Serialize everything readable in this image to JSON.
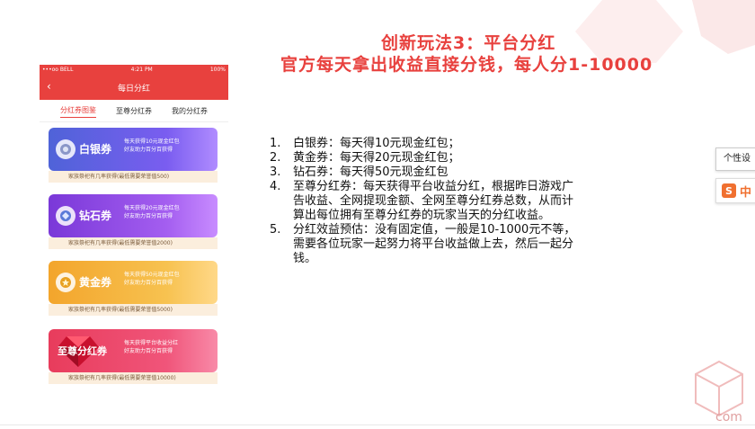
{
  "slide": {
    "title_line1": "创新玩法3：平台分红",
    "title_line2": "官方每天拿出收益直接分钱，每人分1-10000"
  },
  "phone": {
    "status": {
      "carrier": "•••oo BELL",
      "time": "4:21 PM",
      "battery": "100%"
    },
    "nav_title": "每日分红",
    "tabs": [
      {
        "label": "分红券图鉴",
        "active": true
      },
      {
        "label": "至尊分红券",
        "active": false
      },
      {
        "label": "我的分红券",
        "active": false
      }
    ],
    "cards": [
      {
        "name": "白银券",
        "desc1": "每天获得10元现金红包",
        "desc2": "好友助力百分百获得",
        "foot": "家族祭祀有几率获得(最低需要荣誉值500)"
      },
      {
        "name": "钻石券",
        "desc1": "每天获得20元现金红包",
        "desc2": "好友助力百分百获得",
        "foot": "家族祭祀有几率获得(最低需要荣誉值2000)"
      },
      {
        "name": "黄金券",
        "desc1": "每天获得50元现金红包",
        "desc2": "好友助力百分百获得",
        "foot": "家族祭祀有几率获得(最低需要荣誉值5000)"
      },
      {
        "name": "至尊分红券",
        "desc1": "每天获得平台收益分红",
        "desc2": "好友助力百分百获得",
        "foot": "家族祭祀有几率获得(最低需要荣誉值10000)"
      }
    ]
  },
  "list": [
    {
      "num": "1.",
      "text": "白银券：每天得10元现金红包；"
    },
    {
      "num": "2.",
      "text": "黄金券：每天得20元现金红包；"
    },
    {
      "num": "3.",
      "text": "钻石券：每天得50元现金红包"
    },
    {
      "num": "4.",
      "text": "至尊分红券：每天获得平台收益分红，根据昨日游戏广告收益、全网提现金额、全网至尊分红券总数，从而计算出每位拥有至尊分红券的玩家当天的分红收益。"
    },
    {
      "num": "5.",
      "text": "分红效益预估：没有固定值，一般是10-1000元不等，需要各位玩家一起努力将平台收益做上去，然后一起分钱。"
    }
  ],
  "overlay": {
    "tooltip": "个性设",
    "ime_logo": "S",
    "ime_label": "中",
    "watermark": "com"
  },
  "colors": {
    "accent": "#e8413e",
    "ime": "#f07030"
  }
}
